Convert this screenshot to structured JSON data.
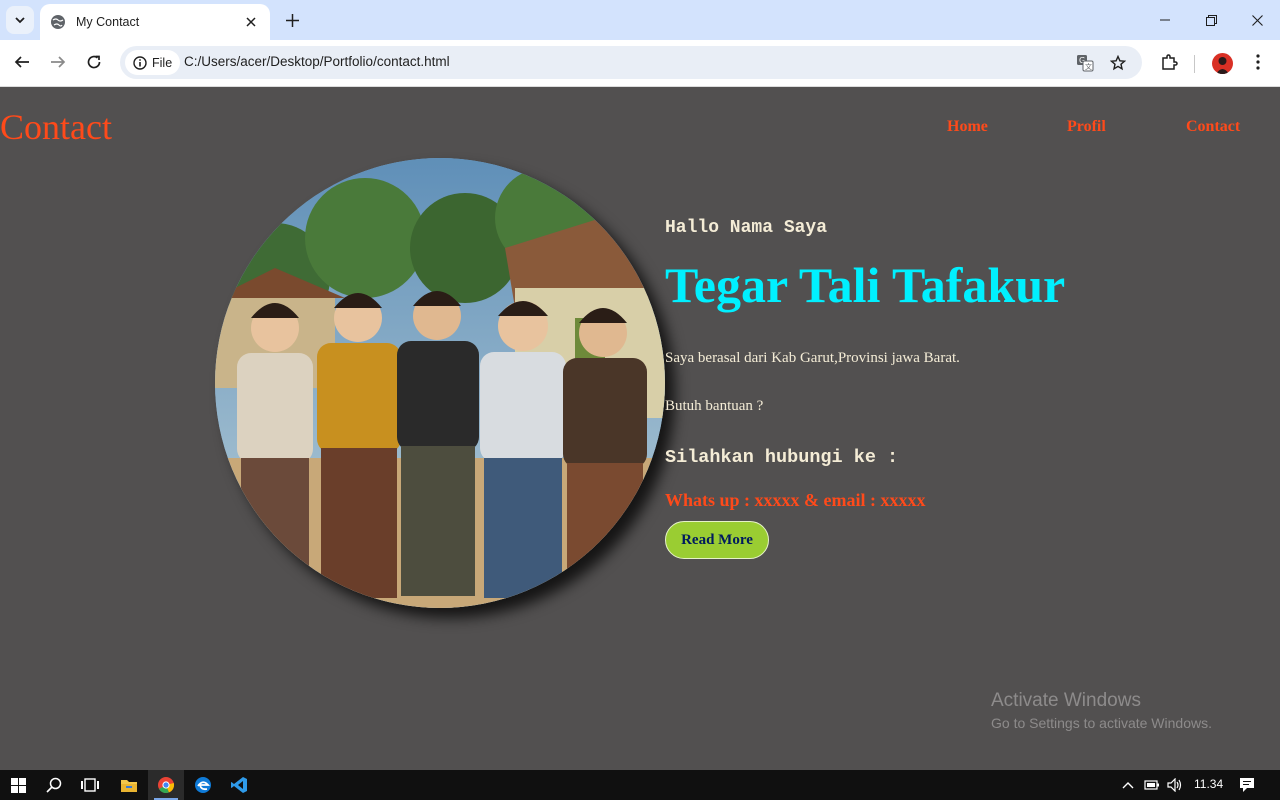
{
  "browser": {
    "tab_title": "My Contact",
    "site_chip_label": "File",
    "url": "C:/Users/acer/Desktop/Portfolio/contact.html"
  },
  "site": {
    "logo": "Contact",
    "nav": [
      "Home",
      "Profil",
      "Contact"
    ]
  },
  "hero": {
    "greeting": "Hallo Nama Saya",
    "name": "Tegar Tali Tafakur",
    "origin_text": "Saya berasal dari Kab Garut,Provinsi jawa Barat.",
    "help_text": "Butuh bantuan ?",
    "contact_heading": "Silahkan hubungi ke :",
    "contact_info": "Whats up : xxxxx & email : xxxxx",
    "button_label": "Read More"
  },
  "watermark": {
    "title": "Activate Windows",
    "subtitle": "Go to Settings to activate Windows."
  },
  "taskbar": {
    "time": "11.34"
  },
  "colors": {
    "page_bg": "#525050",
    "accent_orange": "#ff4a1a",
    "name_cyan": "#00f0ff",
    "text_cream": "#f4ecd6",
    "button_green": "#9acd32"
  },
  "icons": [
    "tab-search-icon",
    "globe-icon",
    "close-icon",
    "plus-icon",
    "minimize-icon",
    "restore-icon",
    "back-icon",
    "forward-icon",
    "reload-icon",
    "info-icon",
    "translate-icon",
    "star-icon",
    "extensions-icon",
    "more-icon",
    "windows-start-icon",
    "search-icon",
    "task-view-icon",
    "file-explorer-icon",
    "chrome-icon",
    "edge-icon",
    "vscode-icon",
    "chevron-up-icon",
    "battery-icon",
    "volume-icon",
    "notification-icon"
  ]
}
